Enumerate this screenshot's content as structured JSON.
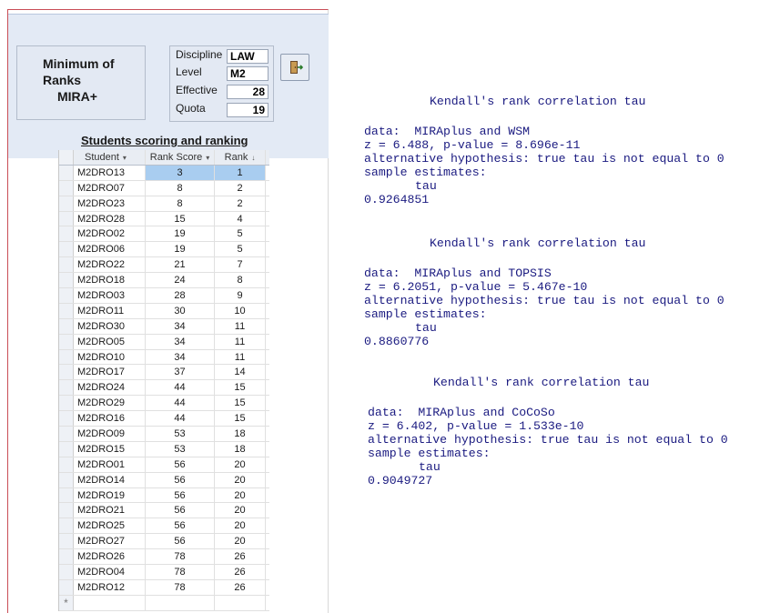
{
  "form": {
    "title_line1": "Minimum of",
    "title_line2": "Ranks",
    "title_line3": "MIRA+",
    "params": {
      "discipline_label": "Discipline",
      "discipline_value": "LAW",
      "level_label": "Level",
      "level_value": "M2",
      "effective_label": "Effective",
      "effective_value": "28",
      "quota_label": "Quota",
      "quota_value": "19"
    },
    "exit_icon": "exit-door-icon",
    "section_caption": "Students scoring and ranking",
    "columns": [
      "Student",
      "Rank Score",
      "Rank"
    ],
    "rows": [
      [
        "M2DRO13",
        "3",
        "1"
      ],
      [
        "M2DRO07",
        "8",
        "2"
      ],
      [
        "M2DRO23",
        "8",
        "2"
      ],
      [
        "M2DRO28",
        "15",
        "4"
      ],
      [
        "M2DRO02",
        "19",
        "5"
      ],
      [
        "M2DRO06",
        "19",
        "5"
      ],
      [
        "M2DRO22",
        "21",
        "7"
      ],
      [
        "M2DRO18",
        "24",
        "8"
      ],
      [
        "M2DRO03",
        "28",
        "9"
      ],
      [
        "M2DRO11",
        "30",
        "10"
      ],
      [
        "M2DRO30",
        "34",
        "11"
      ],
      [
        "M2DRO05",
        "34",
        "11"
      ],
      [
        "M2DRO10",
        "34",
        "11"
      ],
      [
        "M2DRO17",
        "37",
        "14"
      ],
      [
        "M2DRO24",
        "44",
        "15"
      ],
      [
        "M2DRO29",
        "44",
        "15"
      ],
      [
        "M2DRO16",
        "44",
        "15"
      ],
      [
        "M2DRO09",
        "53",
        "18"
      ],
      [
        "M2DRO15",
        "53",
        "18"
      ],
      [
        "M2DRO01",
        "56",
        "20"
      ],
      [
        "M2DRO14",
        "56",
        "20"
      ],
      [
        "M2DRO19",
        "56",
        "20"
      ],
      [
        "M2DRO21",
        "56",
        "20"
      ],
      [
        "M2DRO25",
        "56",
        "20"
      ],
      [
        "M2DRO27",
        "56",
        "20"
      ],
      [
        "M2DRO26",
        "78",
        "26"
      ],
      [
        "M2DRO04",
        "78",
        "26"
      ],
      [
        "M2DRO12",
        "78",
        "26"
      ]
    ],
    "new_row_marker": "*"
  },
  "console": {
    "blocks": [
      {
        "heading": "Kendall's rank correlation tau",
        "data": "data:  MIRAplus and WSM",
        "stat": "z = 6.488, p-value = 8.696e-11",
        "alt": "alternative hypothesis: true tau is not equal to 0",
        "est": "sample estimates:",
        "tau_label": "tau",
        "tau_value": "0.9264851"
      },
      {
        "heading": "Kendall's rank correlation tau",
        "data": "data:  MIRAplus and TOPSIS",
        "stat": "z = 6.2051, p-value = 5.467e-10",
        "alt": "alternative hypothesis: true tau is not equal to 0",
        "est": "sample estimates:",
        "tau_label": "tau",
        "tau_value": "0.8860776"
      },
      {
        "heading": "Kendall's rank correlation tau",
        "data": "data:  MIRAplus and CoCoSo",
        "stat": "z = 6.402, p-value = 1.533e-10",
        "alt": "alternative hypothesis: true tau is not equal to 0",
        "est": "sample estimates:",
        "tau_label": "tau",
        "tau_value": "0.9049727"
      }
    ]
  }
}
